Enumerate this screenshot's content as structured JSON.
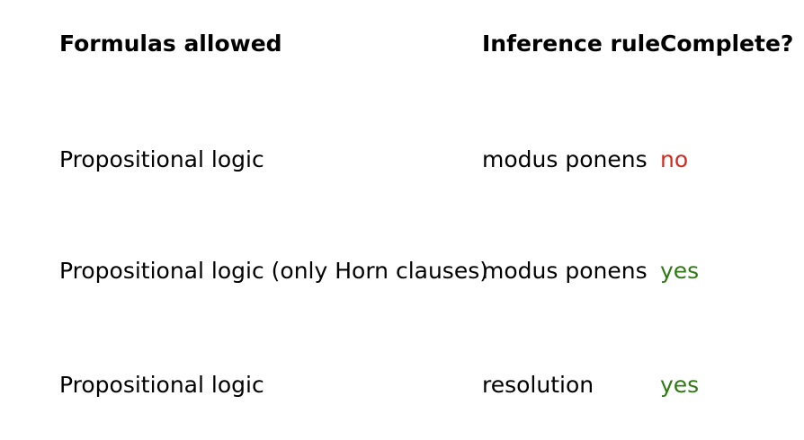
{
  "table": {
    "headers": [
      "Formulas allowed",
      "Inference rule",
      "Complete?"
    ],
    "rows": [
      {
        "formulas": "Propositional logic",
        "rule": "modus ponens",
        "complete": "no",
        "complete_color": "#d42a1e"
      },
      {
        "formulas": "Propositional logic (only Horn clauses)",
        "rule": "modus ponens",
        "complete": "yes",
        "complete_color": "#2f7a14"
      },
      {
        "formulas": "Propositional logic",
        "rule": "resolution",
        "complete": "yes",
        "complete_color": "#2f7a14"
      }
    ]
  }
}
